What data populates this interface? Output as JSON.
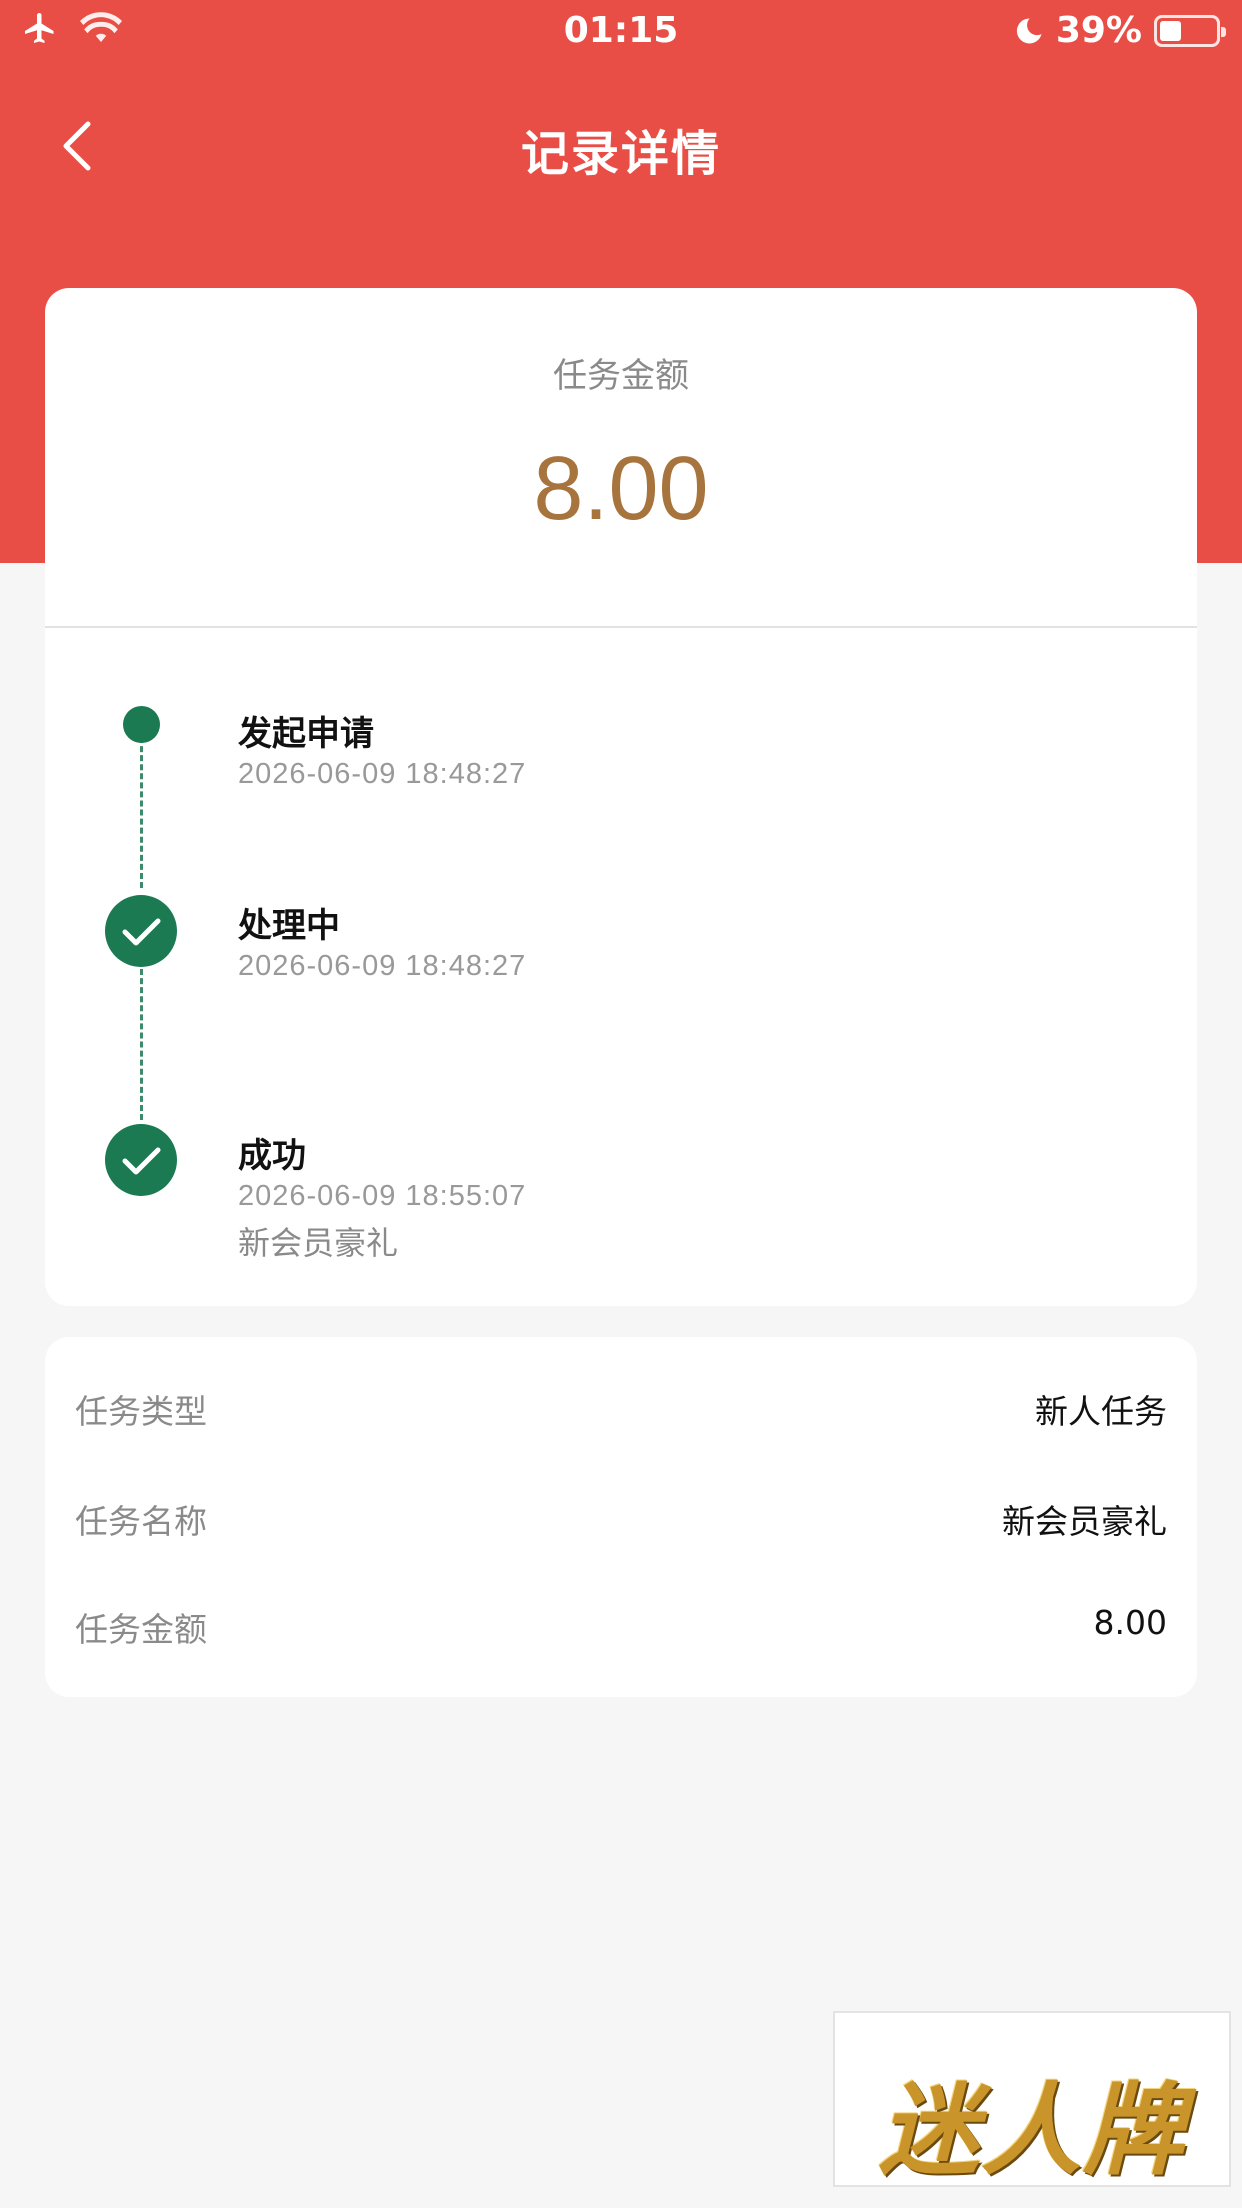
{
  "status_bar": {
    "time": "01:15",
    "battery_percent": "39%",
    "battery_level": 0.39,
    "icons": [
      "airplane-icon",
      "wifi-icon",
      "moon-icon",
      "battery-icon"
    ]
  },
  "nav": {
    "title": "记录详情",
    "back_icon": "chevron-left-icon"
  },
  "summary": {
    "label": "任务金额",
    "amount": "8.00"
  },
  "timeline": [
    {
      "title": "发起申请",
      "time": "2026-06-09 18:48:27",
      "note": ""
    },
    {
      "title": "处理中",
      "time": "2026-06-09 18:48:27",
      "note": ""
    },
    {
      "title": "成功",
      "time": "2026-06-09 18:55:07",
      "note": "新会员豪礼"
    }
  ],
  "details": [
    {
      "key": "任务类型",
      "value": "新人任务"
    },
    {
      "key": "任务名称",
      "value": "新会员豪礼"
    },
    {
      "key": "任务金额",
      "value": "8.00"
    }
  ],
  "watermark": {
    "text": "迷人牌"
  },
  "colors": {
    "header_red": "#e94e46",
    "amount_gold": "#a8743e",
    "timeline_green": "#1b7a52",
    "background": "#f6f6f6"
  }
}
